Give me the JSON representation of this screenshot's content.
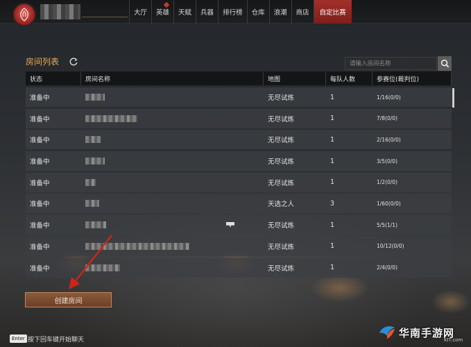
{
  "nav": {
    "items": [
      {
        "label": "大厅"
      },
      {
        "label": "英雄"
      },
      {
        "label": "天赋"
      },
      {
        "label": "兵器"
      },
      {
        "label": "排行榜"
      },
      {
        "label": "仓库"
      },
      {
        "label": "浪潮"
      },
      {
        "label": "商店"
      },
      {
        "label": "自定比赛"
      }
    ],
    "active": "自定比赛"
  },
  "panel": {
    "title": "房间列表",
    "search_placeholder": "请输入房间名称"
  },
  "table": {
    "columns": [
      "状态",
      "房间名称",
      "地图",
      "每队人数",
      "参赛位(裁判位)"
    ],
    "rows": [
      {
        "status": "准备中",
        "map": "无尽试炼",
        "team_size": "1",
        "slots": "1/16(0/0)"
      },
      {
        "status": "准备中",
        "map": "无尽试炼",
        "team_size": "1",
        "slots": "7/8(0/0)"
      },
      {
        "status": "准备中",
        "map": "无尽试炼",
        "team_size": "1",
        "slots": "2/16(0/0)"
      },
      {
        "status": "准备中",
        "map": "无尽试炼",
        "team_size": "1",
        "slots": "3/5(0/0)"
      },
      {
        "status": "准备中",
        "map": "无尽试炼",
        "team_size": "1",
        "slots": "1/2(0/0)"
      },
      {
        "status": "准备中",
        "map": "天选之人",
        "team_size": "3",
        "slots": "1/60(0/0)"
      },
      {
        "status": "准备中",
        "map": "无尽试炼",
        "team_size": "1",
        "slots": "5/5(1/1)"
      },
      {
        "status": "准备中",
        "map": "无尽试炼",
        "team_size": "1",
        "slots": "10/12(0/0)"
      },
      {
        "status": "准备中",
        "map": "无尽试炼",
        "team_size": "1",
        "slots": "2/4(0/0)"
      }
    ]
  },
  "create_button": "创建房间",
  "chat": {
    "key": "Enter",
    "hint": "按下回车键开始聊天"
  },
  "watermark": {
    "text": "华南手游网",
    "sub": "KIT.com"
  },
  "colors": {
    "accent": "#a3302a",
    "title": "#e8a85a",
    "button": "#7a4c30"
  }
}
